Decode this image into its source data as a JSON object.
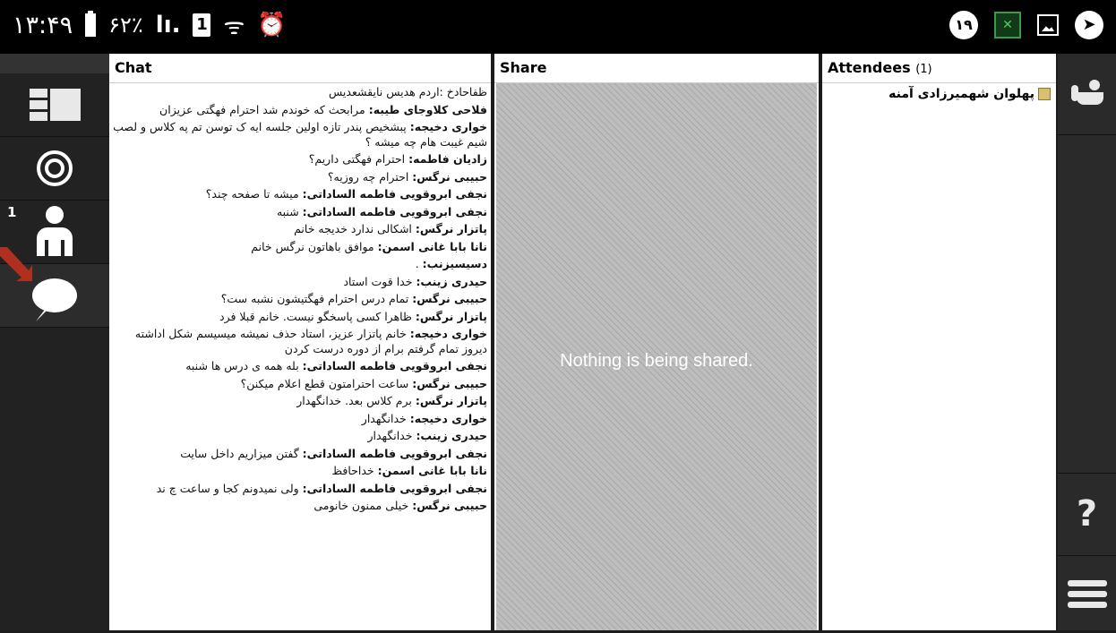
{
  "status_bar": {
    "time": "۱۳:۴۹",
    "battery": "۶۲٪",
    "signal": "lı.",
    "sim": "1",
    "wifi": "ᯤ",
    "alarm": "⏰",
    "notification_count": "۱۹",
    "app_glyph": "✕",
    "nav_glyph": "➤"
  },
  "left_nav": {
    "participants_count": "1"
  },
  "chat": {
    "title": "Chat",
    "messages": [
      {
        "text": "ظفاحادخ :اردم هدیس نایقشعدیس"
      },
      {
        "sender": "فلاحی کلاوجای طیبه:",
        "text": " مرابحث که خوندم شد احترام فهگتی عزیزان"
      },
      {
        "sender": "خواری دخیجه:",
        "text": " پبشخیص پندر تازه اولین جلسه ایه ک توسن تم په کلاس و لصب شیم غیبت هام چه میشه ؟"
      },
      {
        "sender": "زادیان فاطمه:",
        "text": " احترام فهگتی داریم؟"
      },
      {
        "sender": "حبیبی نرگس:",
        "text": " احترام چه روزیه؟"
      },
      {
        "sender": "نجفی ابروقویی فاطمه الساداتی:",
        "text": " میشه تا صفحه چند؟"
      },
      {
        "sender": "نجفی ابروقویی فاطمه الساداتی:",
        "text": " شنبه"
      },
      {
        "sender": "پاتزار نرگس:",
        "text": " اشکالی ندارد خدیجه خانم"
      },
      {
        "sender": "نانا بابا غانی اسمن:",
        "text": " موافق باهاتون نرگس خانم"
      },
      {
        "sender": "دسیسیزنب:",
        "text": " ."
      },
      {
        "sender": "حیدری زینب:",
        "text": " خدا قوت استاد"
      },
      {
        "sender": "حبیبی نرگس:",
        "text": " تمام درس احترام فهگتیشون نشبه ست؟"
      },
      {
        "sender": "پاتزار نرگس:",
        "text": " ظاهرا کسی پاسخگو نیست. خانم قبلا فرد"
      },
      {
        "sender": "خواری دخیجه:",
        "text": " خانم پاتزار عزیز، استاد حذف نمیشه میسیسم شکل اداشته دیروز تمام گرفتم برام از دوره درست کردن"
      },
      {
        "sender": "نجفی ابروقویی فاطمه الساداتی:",
        "text": " بله همه ی درس ها شنبه"
      },
      {
        "sender": "حبیبی نرگس:",
        "text": " ساعت احترامتون قطع اعلام میکنن؟"
      },
      {
        "sender": "پاتزار نرگس:",
        "text": " برم کلاس بعد. خدانگهدار"
      },
      {
        "sender": "خواری دخیجه:",
        "text": " خدانگهدار"
      },
      {
        "sender": "حیدری زینب:",
        "text": " خدانگهدار"
      },
      {
        "sender": "نجفی ابروقویی فاطمه الساداتی:",
        "text": " گفتن میزاریم داخل سایت"
      },
      {
        "sender": "نانا بابا غانی اسمن:",
        "text": " خداحافظ"
      },
      {
        "sender": "نجفی ابروقویی فاطمه الساداتی:",
        "text": " ولی نمیدونم کجا و ساعت چ ند"
      },
      {
        "sender": "حبیبی نرگس:",
        "text": " خیلی ممنون خانومی"
      }
    ]
  },
  "share": {
    "title": "Share",
    "empty_message": "Nothing is being shared."
  },
  "attendees": {
    "title": "Attendees",
    "count": "(1)",
    "list": [
      {
        "name": "پهلوان شهمیرزادی آمنه"
      }
    ]
  },
  "right_bar": {
    "help_label": "?"
  }
}
